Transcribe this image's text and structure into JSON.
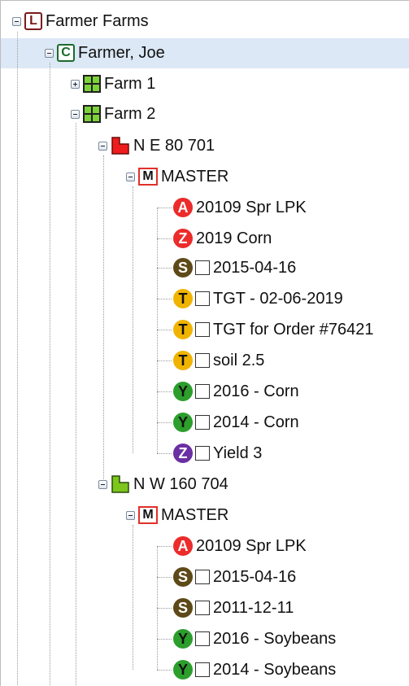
{
  "colors": {
    "selection_bg": "#dce8f6",
    "A": "#ec2b2b",
    "Z_red": "#ec2b2b",
    "S": "#5e4a18",
    "T": "#f0b400",
    "Y": "#2c9e2c",
    "Z_purple": "#6b2fa3",
    "field_red": "#ee1c1c",
    "field_green": "#7dc61e"
  },
  "tree": {
    "root": {
      "label": "Farmer Farms",
      "badge": "L"
    },
    "client": {
      "label": "Farmer, Joe",
      "badge": "C"
    },
    "farm1": {
      "label": "Farm 1"
    },
    "farm2": {
      "label": "Farm 2"
    },
    "field1": {
      "label": "N E 80 701",
      "master": {
        "label": "MASTER",
        "badge": "M"
      },
      "items": [
        {
          "badge": "A",
          "label": "20109 Spr LPK"
        },
        {
          "badge": "Z",
          "label": "2019 Corn"
        },
        {
          "badge": "S",
          "label": "2015-04-16"
        },
        {
          "badge": "T",
          "label": "TGT - 02-06-2019"
        },
        {
          "badge": "T",
          "label": "TGT for Order #76421"
        },
        {
          "badge": "T",
          "label": "soil 2.5"
        },
        {
          "badge": "Y",
          "label": "2016 - Corn"
        },
        {
          "badge": "Y",
          "label": "2014 - Corn"
        },
        {
          "badge": "Z",
          "label": "Yield 3"
        }
      ]
    },
    "field2": {
      "label": "N W 160 704",
      "master": {
        "label": "MASTER",
        "badge": "M"
      },
      "items": [
        {
          "badge": "A",
          "label": "20109 Spr LPK"
        },
        {
          "badge": "S",
          "label": "2015-04-16"
        },
        {
          "badge": "S",
          "label": "2011-12-11"
        },
        {
          "badge": "Y",
          "label": "2016 - Soybeans"
        },
        {
          "badge": "Y",
          "label": "2014 - Soybeans"
        }
      ]
    }
  }
}
